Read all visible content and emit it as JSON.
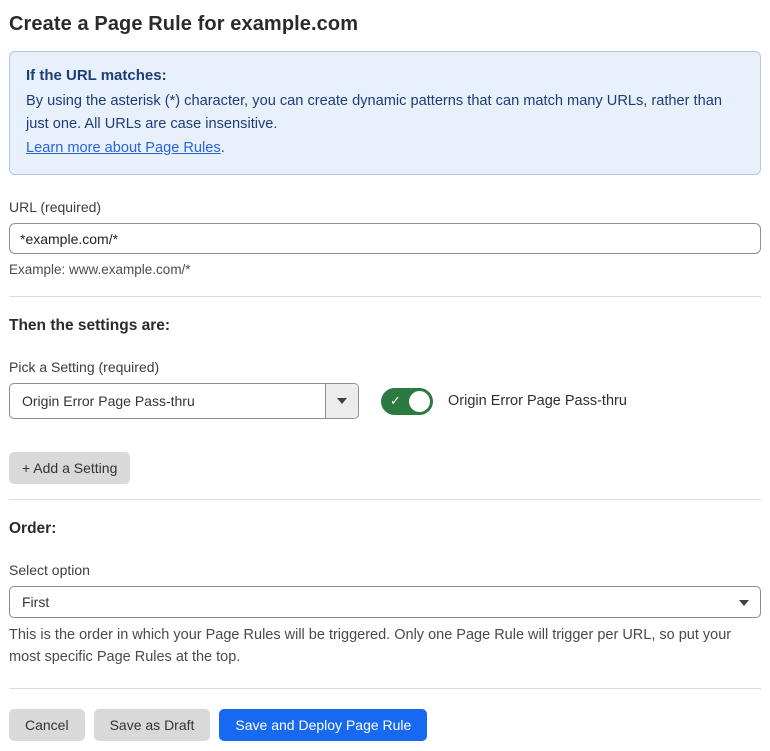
{
  "page": {
    "title": "Create a Page Rule for example.com"
  },
  "info_box": {
    "heading": "If the URL matches:",
    "body": "By using the asterisk (*) character, you can create dynamic patterns that can match many URLs, rather than just one. All URLs are case insensitive.",
    "link_label": "Learn more about Page Rules",
    "link_suffix": "."
  },
  "url_field": {
    "label": "URL (required)",
    "value": "*example.com/*",
    "helper": "Example: www.example.com/*"
  },
  "settings_section": {
    "heading": "Then the settings are:",
    "picker_label": "Pick a Setting (required)",
    "selected_setting": "Origin Error Page Pass-thru",
    "toggle_state": "on",
    "toggle_check_glyph": "✓",
    "toggle_label": "Origin Error Page Pass-thru",
    "add_setting_label": "+ Add a Setting"
  },
  "order_section": {
    "heading": "Order:",
    "select_label": "Select option",
    "selected_option": "First",
    "helper": "This is the order in which your Page Rules will be triggered. Only one Page Rule will trigger per URL, so put your most specific Page Rules at the top."
  },
  "footer": {
    "cancel_label": "Cancel",
    "save_draft_label": "Save as Draft",
    "save_deploy_label": "Save and Deploy Page Rule"
  },
  "colors": {
    "info_background": "#e8f1fb",
    "info_border": "#a9c9ee",
    "info_text": "#1d3c78",
    "link_blue": "#2b63d9",
    "primary_blue": "#1769f2",
    "toggle_green": "#2b7a41",
    "gray_button": "#d9d9d9"
  }
}
